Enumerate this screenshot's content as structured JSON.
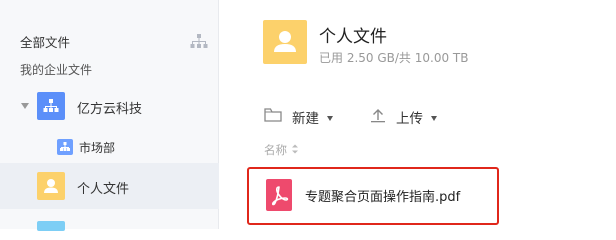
{
  "sidebar": {
    "header": "全部文件",
    "subheader": "我的企业文件",
    "items": [
      {
        "label": "亿方云科技",
        "icon": "org-icon"
      },
      {
        "label": "市场部",
        "icon": "org-icon"
      },
      {
        "label": "个人文件",
        "icon": "user-folder-icon",
        "selected": true
      },
      {
        "label": "",
        "icon": "folder-icon"
      }
    ]
  },
  "header": {
    "title": "个人文件",
    "usage": "已用 2.50 GB/共 10.00 TB"
  },
  "toolbar": {
    "new_label": "新建",
    "upload_label": "上传"
  },
  "list": {
    "column_name": "名称",
    "files": [
      {
        "name": "专题聚合页面操作指南.pdf",
        "icon": "pdf-icon"
      }
    ]
  },
  "colors": {
    "accent_blue": "#5b8ff9",
    "folder_yellow": "#fcd16b",
    "pdf_pink": "#ee4a6d",
    "highlight_red": "#e0271b"
  }
}
